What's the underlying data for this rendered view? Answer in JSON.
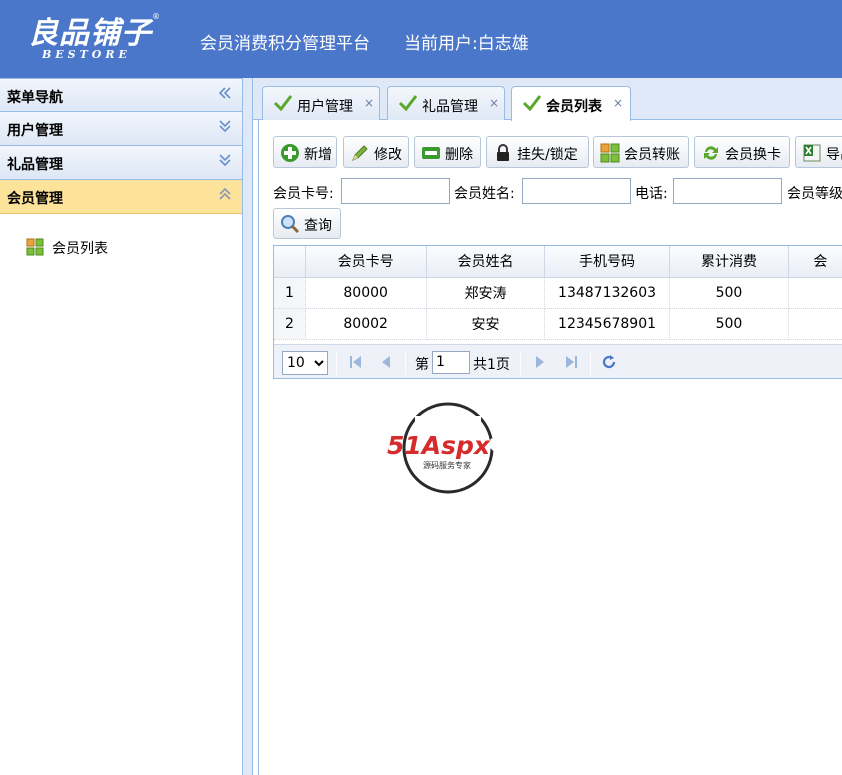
{
  "header": {
    "logo_text": "良品铺子",
    "logo_reg": "®",
    "logo_sub": "BESTORE",
    "title": "会员消费积分管理平台",
    "current_user": "当前用户:白志雄"
  },
  "sidebar": {
    "panels": [
      {
        "label": "菜单导航",
        "chevron": "«"
      },
      {
        "label": "用户管理",
        "chevron": "⌄"
      },
      {
        "label": "礼品管理",
        "chevron": "⌄"
      },
      {
        "label": "会员管理",
        "chevron": "⌃"
      }
    ],
    "items": [
      {
        "label": "会员列表",
        "icon": "grid-icon"
      }
    ]
  },
  "tabs": [
    {
      "label": "用户管理",
      "close": "×"
    },
    {
      "label": "礼品管理",
      "close": "×"
    },
    {
      "label": "会员列表",
      "close": "×",
      "active": true
    }
  ],
  "toolbar": {
    "add": "新增",
    "edit": "修改",
    "delete": "删除",
    "lock": "挂失/锁定",
    "transfer": "会员转账",
    "card": "会员换卡",
    "export": "导出"
  },
  "search": {
    "card_label": "会员卡号:",
    "name_label": "会员姓名:",
    "phone_label": "电话:",
    "level_label": "会员等级",
    "query": "查询"
  },
  "grid": {
    "columns": [
      "会员卡号",
      "会员姓名",
      "手机号码",
      "累计消费",
      "会"
    ],
    "rows": [
      {
        "n": "1",
        "card": "80000",
        "name": "郑安涛",
        "phone": "13487132603",
        "total": "500"
      },
      {
        "n": "2",
        "card": "80002",
        "name": "安安",
        "phone": "12345678901",
        "total": "500"
      }
    ]
  },
  "pager": {
    "page_size": "10",
    "page_label": "第",
    "page_value": "1",
    "total_label": "共1页"
  },
  "watermark": {
    "brand": "51Aspx",
    "tagline": "源码服务专家"
  },
  "colors": {
    "header_bg": "#4a77c9",
    "active_panel": "#fde29a",
    "border": "#99bbe8"
  }
}
